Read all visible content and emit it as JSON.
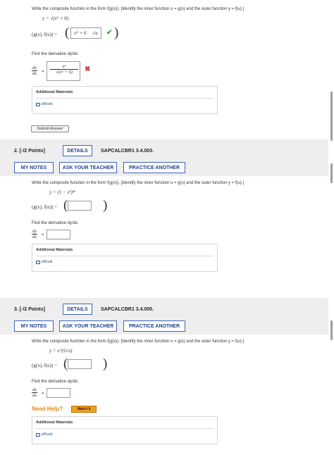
{
  "q1": {
    "prompt": "Write the composite function in the form f(g(x)). [Identify the inner function  u = g(x)  and the outer function  y = f(u).]",
    "equation": "y = √(x⁶ + 6)",
    "pair_label": "(g(x), f(u)) =",
    "inner_answer": "x⁶ + 6",
    "outer_answer": "√u",
    "derivative_prompt": "Find the derivative  dy/dx.",
    "dy": "dy",
    "dx": "dx",
    "answer_num": "x⁵",
    "answer_den": "√(x⁶ + 6)",
    "additional": "Additional Materials",
    "ebook": "eBook",
    "submit": "Submit Answer"
  },
  "q2": {
    "number": "2.  [-/2 Points]",
    "details": "DETAILS",
    "code": "SAPCALCBR1 3.4.003.",
    "my_notes": "MY NOTES",
    "ask": "ASK YOUR TEACHER",
    "practice": "PRACTICE ANOTHER",
    "prompt": "Write the composite function in the form f(g(x)). [Identify the inner function  u = g(x)  and the outer function  y = f(u).]",
    "equation": "y = (1 − x²)¹⁶",
    "pair_label": "(g(x), f(u)) =",
    "derivative_prompt": "Find the derivative  dy/dx.",
    "dy": "dy",
    "dx": "dx",
    "additional": "Additional Materials",
    "ebook": "eBook"
  },
  "q3": {
    "number": "3.  [-/2 Points]",
    "details": "DETAILS",
    "code": "SAPCALCBR1 3.4.005.",
    "my_notes": "MY NOTES",
    "ask": "ASK YOUR TEACHER",
    "practice": "PRACTICE ANOTHER",
    "prompt": "Write the composite function in the form f(g(x)). [Identify the inner function  u = g(x)  and the outer function  y = f(u).]",
    "equation": "y = e^(5√x)",
    "pair_label": "(g(x), f(u)) =",
    "derivative_prompt": "Find the derivative  dy/dx.",
    "dy": "dy",
    "dx": "dx",
    "need_help": "Need Help?",
    "watch": "Watch It",
    "additional": "Additional Materials",
    "ebook": "eBook"
  },
  "colors": {
    "correct": "#3aa34a",
    "incorrect": "#d23b3b",
    "button_border": "#3b66b8",
    "need_help": "#e08a1e",
    "watch": "#f0a020"
  },
  "icons": [
    "check-icon",
    "x-icon",
    "ebook-icon"
  ]
}
